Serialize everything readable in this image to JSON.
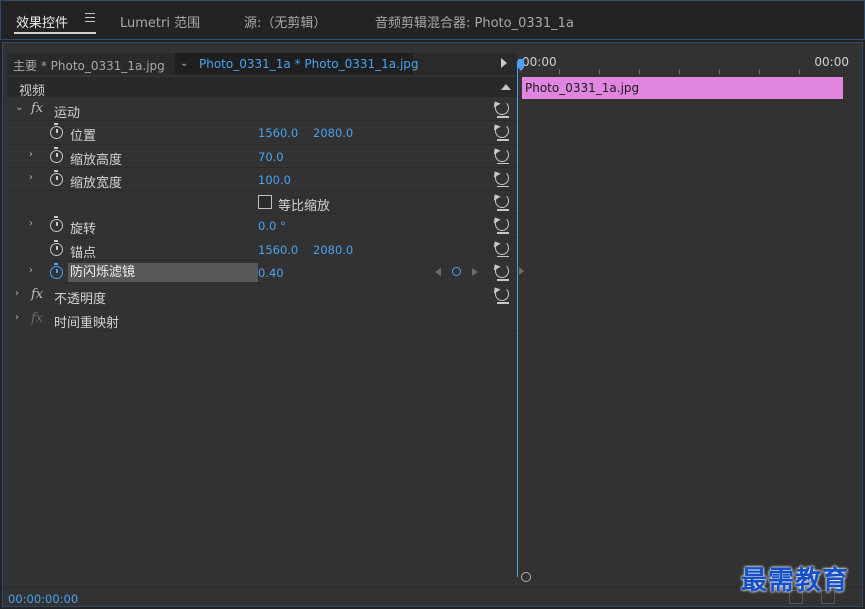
{
  "tabs": [
    {
      "label": "效果控件"
    },
    {
      "label": "Lumetri 范围"
    },
    {
      "label": "源:（无剪辑）"
    },
    {
      "label": "音频剪辑混合器: Photo_0331_1a"
    }
  ],
  "clip_header": {
    "master_label": "主要 * Photo_0331_1a.jpg",
    "sequence_label": "Photo_0331_1a * Photo_0331_1a.jpg"
  },
  "section": {
    "label": "视频"
  },
  "rows": [
    {
      "name": "运动"
    },
    {
      "name": "位置",
      "v1": "1560.0",
      "v2": "2080.0"
    },
    {
      "name": "缩放高度",
      "v1": "70.0"
    },
    {
      "name": "缩放宽度",
      "v1": "100.0"
    },
    {
      "checkbox_label": "等比缩放"
    },
    {
      "name": "旋转",
      "v1": "0.0 °"
    },
    {
      "name": "锚点",
      "v1": "1560.0",
      "v2": "2080.0"
    },
    {
      "name": "防闪烁滤镜",
      "v1": "0.40"
    },
    {
      "name": "不透明度"
    },
    {
      "name": "时间重映射"
    }
  ],
  "timeline": {
    "time_start": "00:00",
    "time_end": "00:00",
    "clip_label": "Photo_0331_1a.jpg",
    "clip_color": "#e086e0"
  },
  "footer": {
    "timecode": "00:00:00:00"
  },
  "watermark": "最需教育",
  "colors": {
    "accent": "#4aa2f0",
    "panel": "#323232"
  }
}
